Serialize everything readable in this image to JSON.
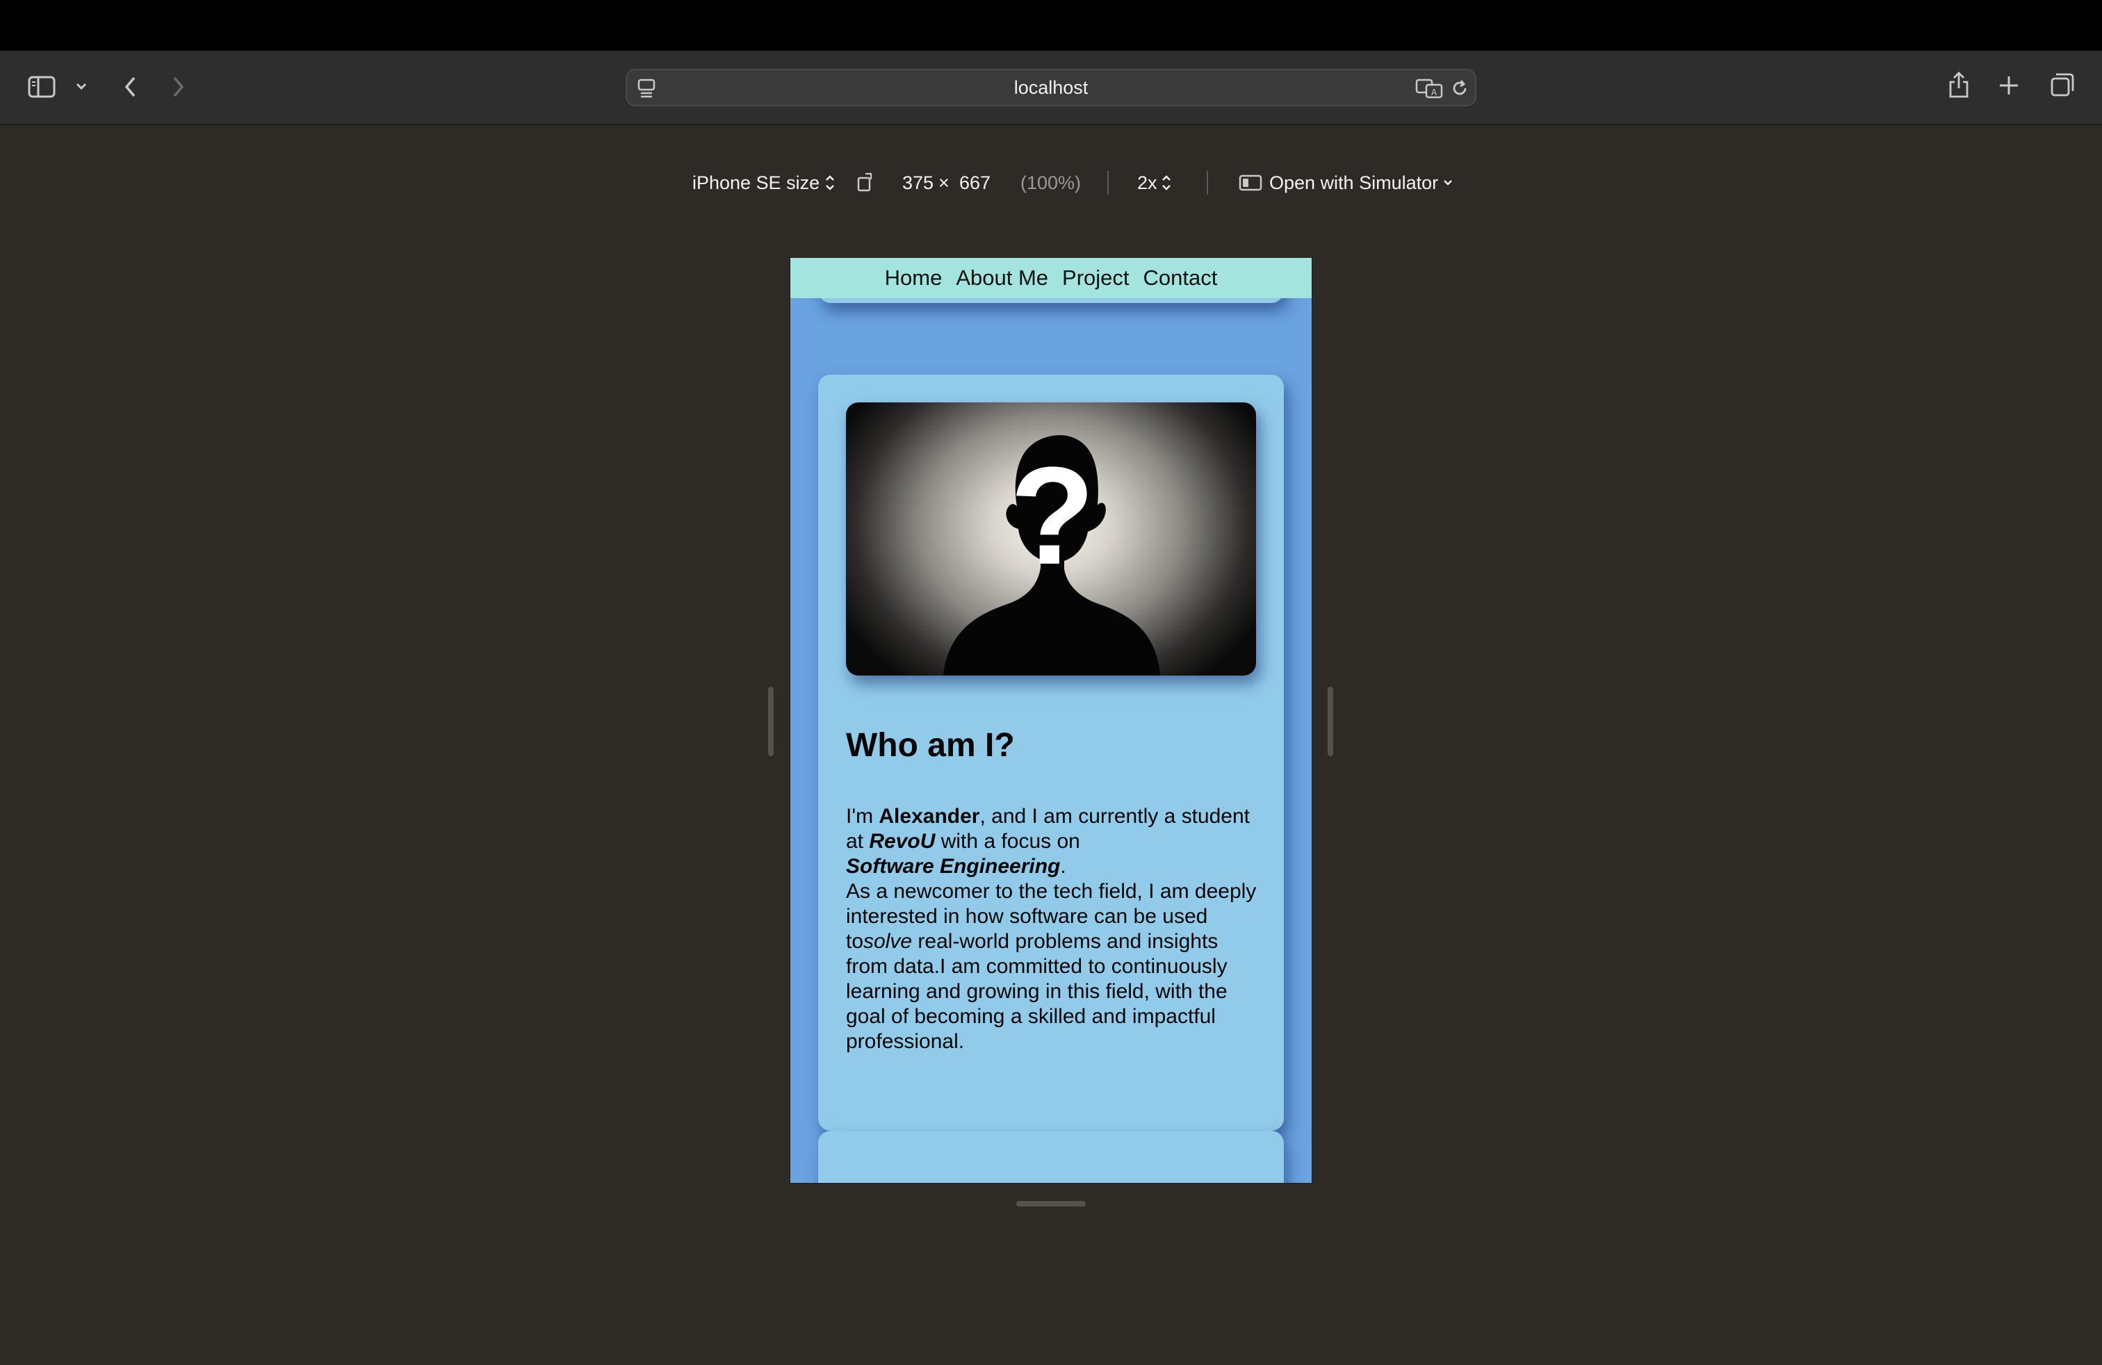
{
  "browser": {
    "url": "localhost"
  },
  "responsive_toolbar": {
    "device": "iPhone SE size",
    "width": "375",
    "times": "×",
    "height": "667",
    "zoom": "(100%)",
    "scale": "2x",
    "simulator": "Open with Simulator"
  },
  "site": {
    "nav": {
      "home": "Home",
      "about": "About Me",
      "project": "Project",
      "contact": "Contact"
    },
    "about": {
      "heading": "Who am I?",
      "p1": "I'm ",
      "name": "Alexander",
      "p2": ", and I am currently a student at ",
      "school": "RevoU",
      "p3": " with a focus on ",
      "focus": "Software Engineering",
      "p4": ".",
      "p5": "As a newcomer to the tech field, I am deeply interested in how software can be used to",
      "solve": "solve",
      "p6": " real-world problems and insights from data.I am committed to continuously learning and growing in this field, with the goal of becoming a skilled and impactful professional."
    }
  }
}
